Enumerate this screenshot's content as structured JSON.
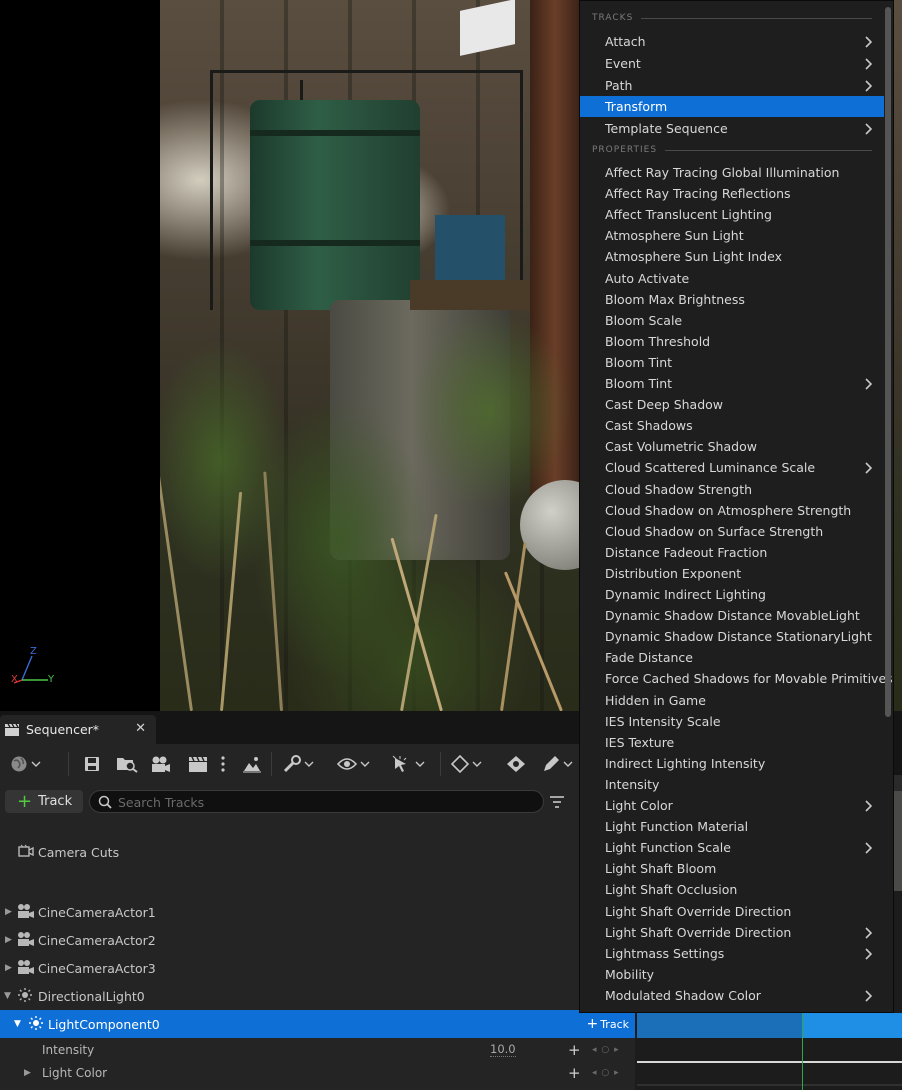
{
  "viewport": {
    "axis": {
      "z": "Z",
      "x": "X",
      "y": "Y"
    }
  },
  "sequencer": {
    "tab_title": "Sequencer*",
    "toolbar_icons": [
      "world-icon",
      "save-icon",
      "find-in-content-icon",
      "camera-actor-icon",
      "clapperboard-icon",
      "more-options-icon",
      "cinematic-icon",
      "wrench-icon",
      "eye-icon",
      "snap-icon",
      "keyframe-icon",
      "auto-key-icon",
      "edit-icon"
    ],
    "add_track_label": "Track",
    "search_placeholder": "Search Tracks",
    "tracks": [
      {
        "label": "Camera Cuts",
        "icon": "camera-cuts-icon"
      },
      {
        "label": "CineCameraActor1",
        "icon": "camera-actor-icon"
      },
      {
        "label": "CineCameraActor2",
        "icon": "camera-actor-icon"
      },
      {
        "label": "CineCameraActor3",
        "icon": "camera-actor-icon"
      },
      {
        "label": "DirectionalLight0",
        "icon": "directional-light-icon"
      },
      {
        "label": "LightComponent0",
        "icon": "directional-light-icon",
        "add_label": "Track"
      }
    ],
    "properties": [
      {
        "label": "Intensity",
        "value": "10.0"
      },
      {
        "label": "Light Color"
      }
    ]
  },
  "menu": {
    "tracks_header": "TRACKS",
    "properties_header": "PROPERTIES",
    "tracks_items": [
      {
        "label": "Attach",
        "submenu": true
      },
      {
        "label": "Event",
        "submenu": true
      },
      {
        "label": "Path",
        "submenu": true
      },
      {
        "label": "Transform",
        "submenu": false,
        "selected": true
      },
      {
        "label": "Template Sequence",
        "submenu": true
      }
    ],
    "property_items": [
      {
        "label": "Affect Ray Tracing Global Illumination"
      },
      {
        "label": "Affect Ray Tracing Reflections"
      },
      {
        "label": "Affect Translucent Lighting"
      },
      {
        "label": "Atmosphere Sun Light"
      },
      {
        "label": "Atmosphere Sun Light Index"
      },
      {
        "label": "Auto Activate"
      },
      {
        "label": "Bloom Max Brightness"
      },
      {
        "label": "Bloom Scale"
      },
      {
        "label": "Bloom Threshold"
      },
      {
        "label": "Bloom Tint"
      },
      {
        "label": "Bloom Tint",
        "submenu": true
      },
      {
        "label": "Cast Deep Shadow"
      },
      {
        "label": "Cast Shadows"
      },
      {
        "label": "Cast Volumetric Shadow"
      },
      {
        "label": "Cloud Scattered Luminance Scale",
        "submenu": true
      },
      {
        "label": "Cloud Shadow Strength"
      },
      {
        "label": "Cloud Shadow on Atmosphere Strength"
      },
      {
        "label": "Cloud Shadow on Surface Strength"
      },
      {
        "label": "Distance Fadeout Fraction"
      },
      {
        "label": "Distribution Exponent"
      },
      {
        "label": "Dynamic Indirect Lighting"
      },
      {
        "label": "Dynamic Shadow Distance MovableLight"
      },
      {
        "label": "Dynamic Shadow Distance StationaryLight"
      },
      {
        "label": "Fade Distance"
      },
      {
        "label": "Force Cached Shadows for Movable Primitives"
      },
      {
        "label": "Hidden in Game"
      },
      {
        "label": "IES Intensity Scale"
      },
      {
        "label": "IES Texture"
      },
      {
        "label": "Indirect Lighting Intensity"
      },
      {
        "label": "Intensity"
      },
      {
        "label": "Light Color",
        "submenu": true
      },
      {
        "label": "Light Function Material"
      },
      {
        "label": "Light Function Scale",
        "submenu": true
      },
      {
        "label": "Light Shaft Bloom"
      },
      {
        "label": "Light Shaft Occlusion"
      },
      {
        "label": "Light Shaft Override Direction"
      },
      {
        "label": "Light Shaft Override Direction",
        "submenu": true
      },
      {
        "label": "Lightmass Settings",
        "submenu": true
      },
      {
        "label": "Mobility"
      },
      {
        "label": "Modulated Shadow Color",
        "submenu": true
      }
    ]
  },
  "colors": {
    "accent": "#0e6fd6",
    "add_green": "#55c842",
    "panel_bg": "#242424",
    "menu_bg": "#1e1e1e"
  }
}
